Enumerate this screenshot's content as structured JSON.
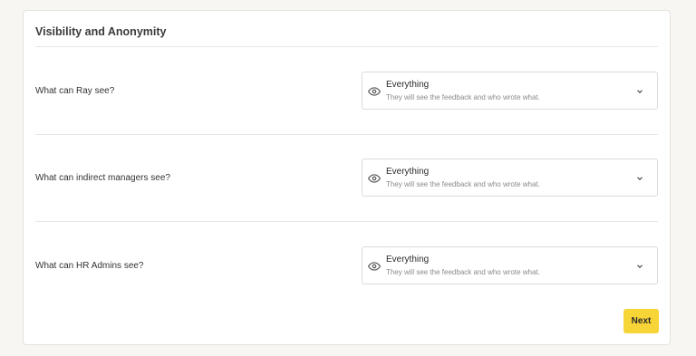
{
  "section": {
    "title": "Visibility and Anonymity"
  },
  "rows": [
    {
      "question": "What can Ray see?",
      "value": "Everything",
      "description": "They will see the feedback and who wrote what."
    },
    {
      "question": "What can indirect managers see?",
      "value": "Everything",
      "description": "They will see the feedback and who wrote what."
    },
    {
      "question": "What can HR Admins see?",
      "value": "Everything",
      "description": "They will see the feedback and who wrote what."
    }
  ],
  "icons": {
    "option_icon": "eye-icon",
    "dropdown_icon": "chevron-down-icon"
  },
  "actions": {
    "next_label": "Next"
  },
  "colors": {
    "accent": "#f7d537",
    "background": "#f8f6f3"
  }
}
